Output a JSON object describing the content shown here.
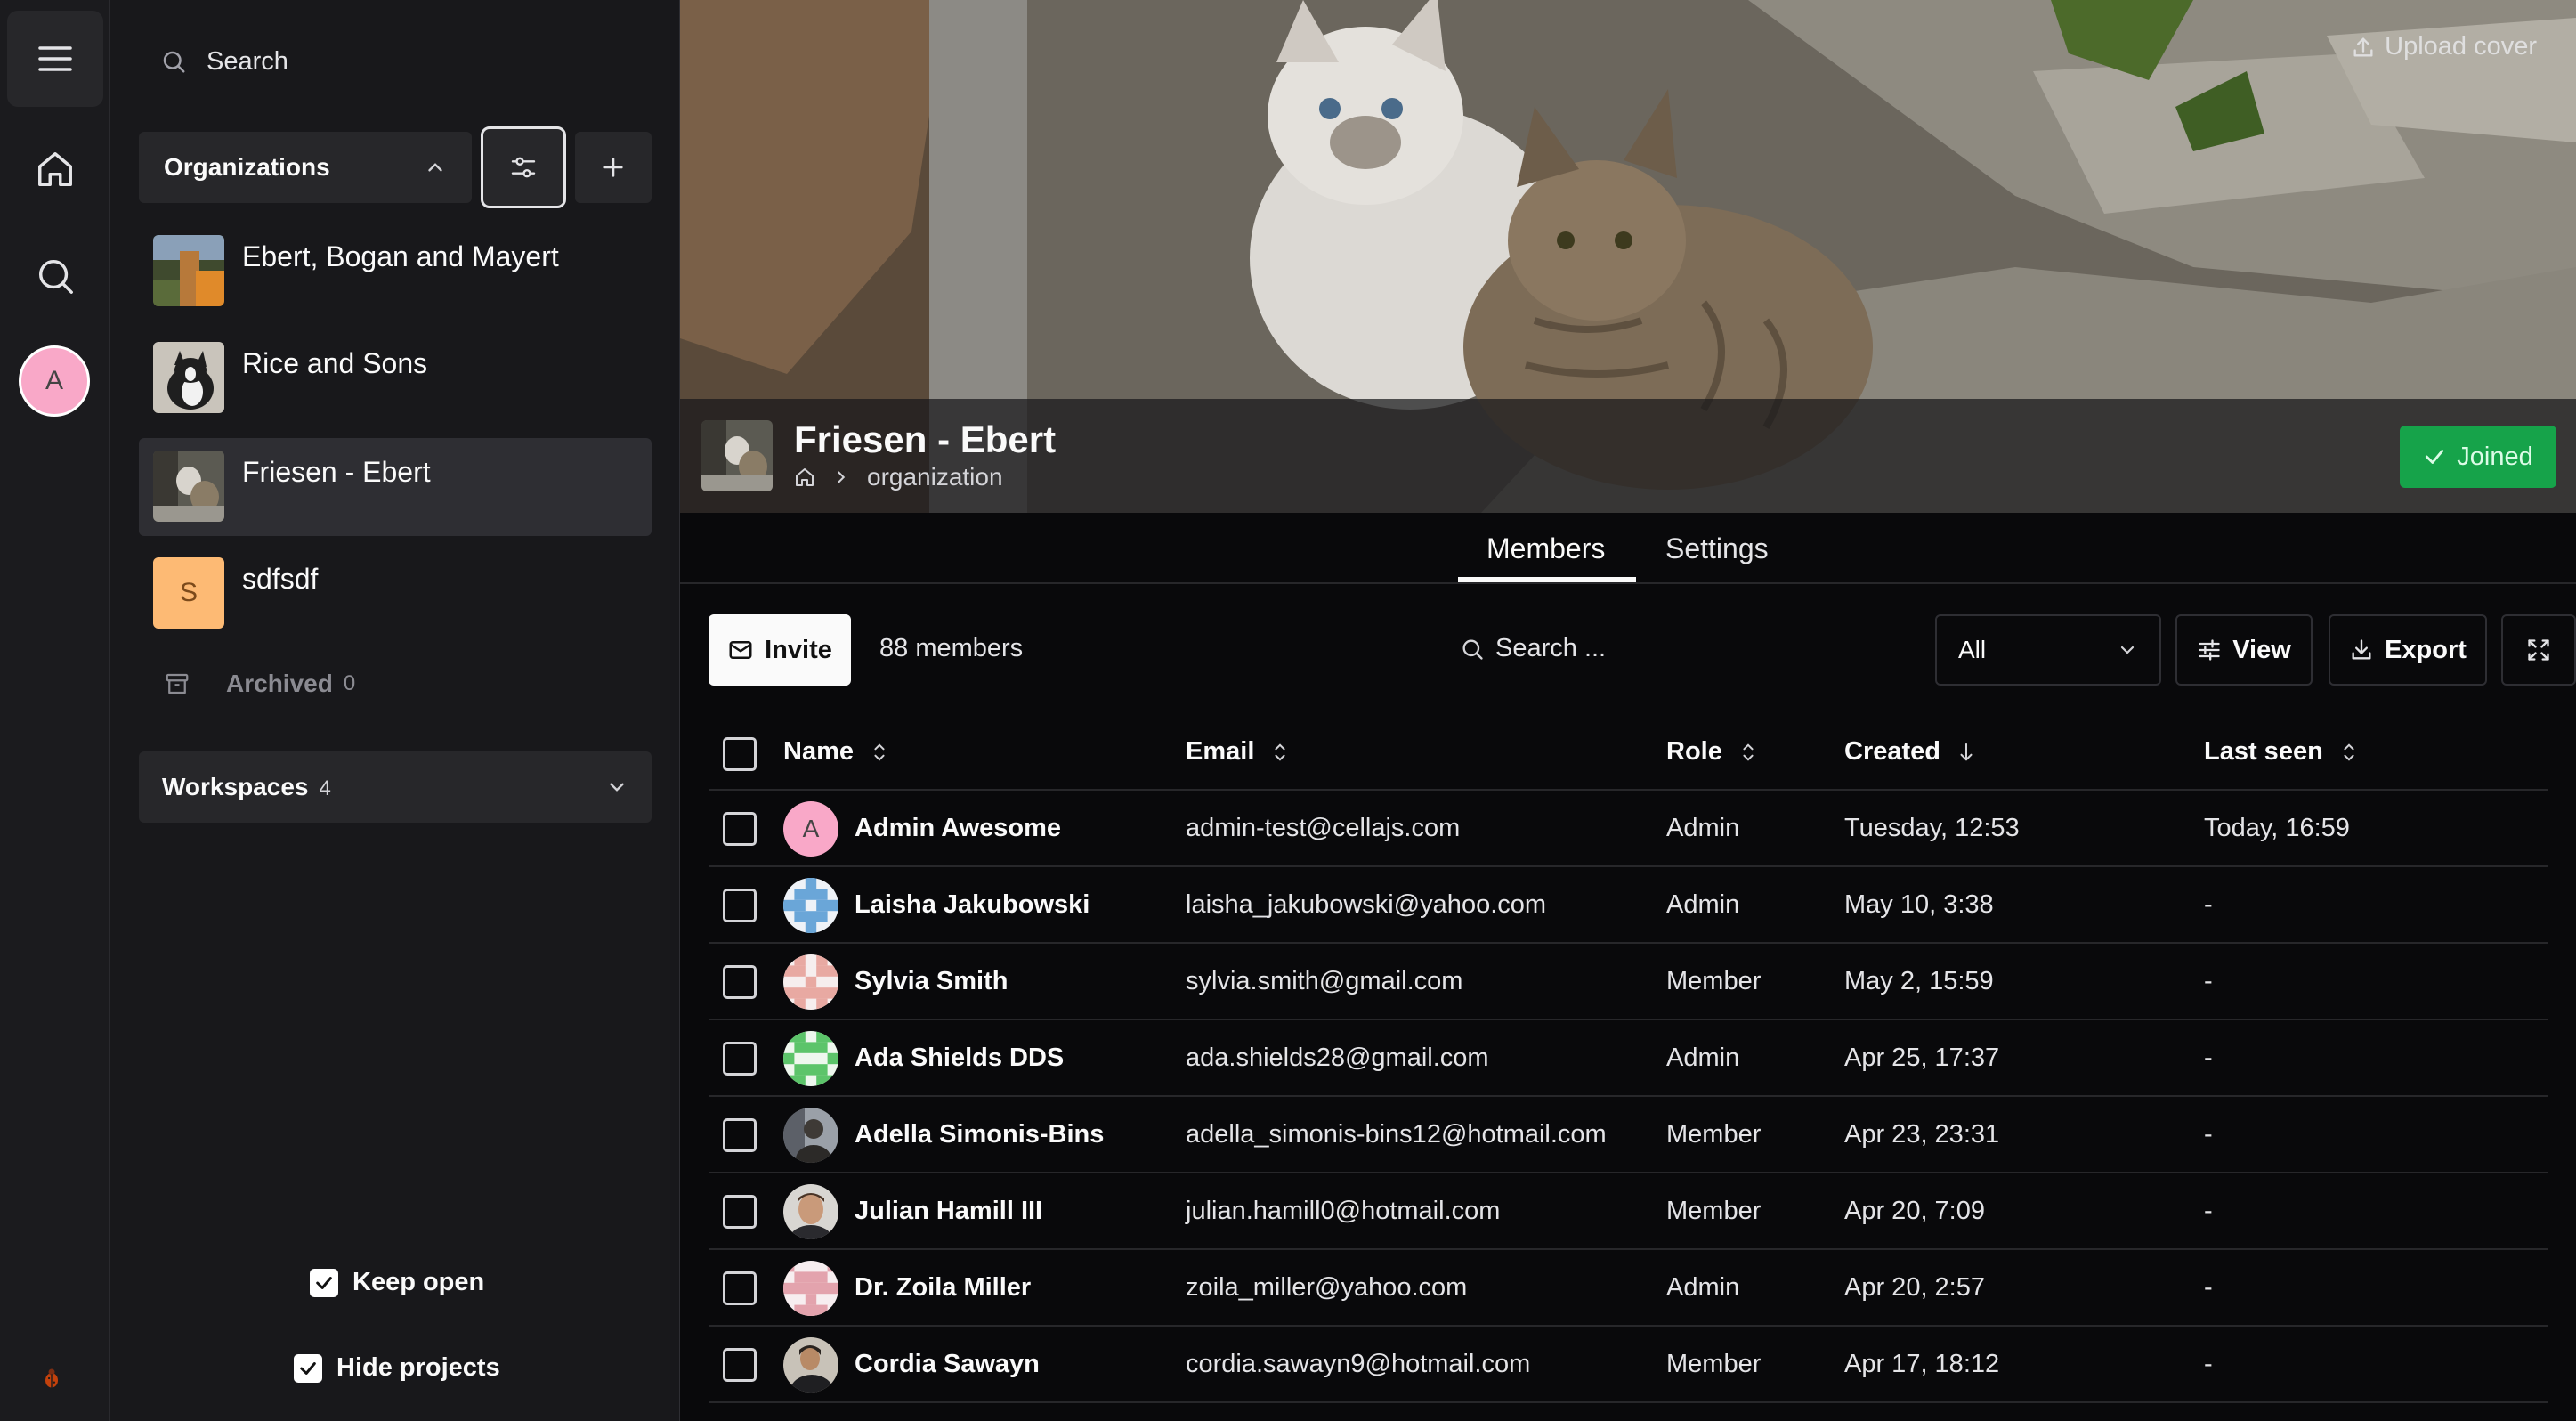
{
  "sidebar": {
    "search_placeholder": "Search",
    "organizations_label": "Organizations",
    "organizations": [
      {
        "name": "Ebert, Bogan and Mayert",
        "active": false
      },
      {
        "name": "Rice and Sons",
        "active": false
      },
      {
        "name": "Friesen - Ebert",
        "active": true
      },
      {
        "name": "sdfsdf",
        "initial": "S",
        "active": false
      }
    ],
    "archived_label": "Archived",
    "archived_count": "0",
    "workspaces_label": "Workspaces",
    "workspaces_count": "4",
    "keep_open_label": "Keep open",
    "hide_projects_label": "Hide projects"
  },
  "rail": {
    "avatar_initial": "A"
  },
  "header": {
    "upload_cover_label": "Upload cover",
    "title": "Friesen - Ebert",
    "breadcrumb": "organization",
    "joined_label": "Joined"
  },
  "tabs": {
    "members": "Members",
    "settings": "Settings"
  },
  "toolbar": {
    "invite_label": "Invite",
    "member_count": "88 members",
    "search_placeholder": "Search ...",
    "role_filter": "All",
    "view_label": "View",
    "export_label": "Export"
  },
  "table": {
    "columns": {
      "name": "Name",
      "email": "Email",
      "role": "Role",
      "created": "Created",
      "last_seen": "Last seen"
    },
    "rows": [
      {
        "name": "Admin Awesome",
        "email": "admin-test@cellajs.com",
        "role": "Admin",
        "created": "Tuesday, 12:53",
        "last_seen": "Today, 16:59",
        "avatar": "A"
      },
      {
        "name": "Laisha Jakubowski",
        "email": "laisha_jakubowski@yahoo.com",
        "role": "Admin",
        "created": "May 10, 3:38",
        "last_seen": "-"
      },
      {
        "name": "Sylvia Smith",
        "email": "sylvia.smith@gmail.com",
        "role": "Member",
        "created": "May 2, 15:59",
        "last_seen": "-"
      },
      {
        "name": "Ada Shields DDS",
        "email": "ada.shields28@gmail.com",
        "role": "Admin",
        "created": "Apr 25, 17:37",
        "last_seen": "-"
      },
      {
        "name": "Adella Simonis-Bins",
        "email": "adella_simonis-bins12@hotmail.com",
        "role": "Member",
        "created": "Apr 23, 23:31",
        "last_seen": "-"
      },
      {
        "name": "Julian Hamill III",
        "email": "julian.hamill0@hotmail.com",
        "role": "Member",
        "created": "Apr 20, 7:09",
        "last_seen": "-"
      },
      {
        "name": "Dr. Zoila Miller",
        "email": "zoila_miller@yahoo.com",
        "role": "Admin",
        "created": "Apr 20, 2:57",
        "last_seen": "-"
      },
      {
        "name": "Cordia Sawayn",
        "email": "cordia.sawayn9@hotmail.com",
        "role": "Member",
        "created": "Apr 17, 18:12",
        "last_seen": "-"
      }
    ]
  },
  "colors": {
    "accent_joined": "#16a34a",
    "rail_avatar": "#f9a8c8",
    "org_initial_bg": "#fdba74"
  }
}
